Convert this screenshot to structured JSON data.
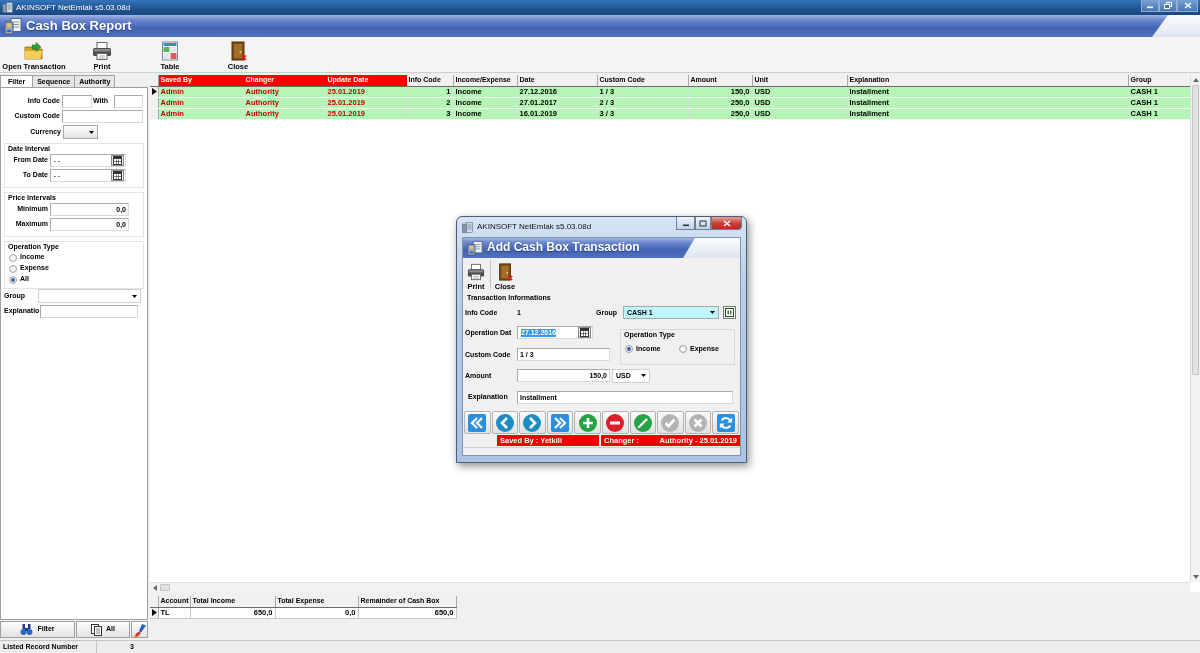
{
  "window": {
    "title": "AKINSOFT NetEmlak s5.03.08d"
  },
  "page_title": "Cash Box Report",
  "toolbar": [
    {
      "kind": "open",
      "label": "Open Transaction"
    },
    {
      "kind": "print",
      "label": "Print"
    },
    {
      "kind": "table",
      "label": "Table"
    },
    {
      "kind": "close",
      "label": "Close"
    }
  ],
  "filter_panel": {
    "tabs": [
      {
        "label": "Filter",
        "selected": true
      },
      {
        "label": "Sequence",
        "selected": false
      },
      {
        "label": "Authority",
        "selected": false
      }
    ],
    "info_code": {
      "label": "Info Code",
      "with_label": "With"
    },
    "custom_code": {
      "label": "Custom Code"
    },
    "currency": {
      "label": "Currency"
    },
    "date_interval": {
      "title": "Date Interval",
      "from_date": {
        "label": "From Date",
        "value": ". ."
      },
      "to_date": {
        "label": "To Date",
        "value": ". ."
      }
    },
    "price_intervals": {
      "title": "Price Intervals",
      "minimum": {
        "label": "Minimum",
        "value": "0,0"
      },
      "maximum": {
        "label": "Maximum",
        "value": "0,0"
      }
    },
    "operation_type": {
      "title": "Operation Type",
      "options": [
        {
          "label": "Income",
          "selected": false
        },
        {
          "label": "Expense",
          "selected": false
        },
        {
          "label": "All",
          "selected": true
        }
      ]
    },
    "group": {
      "label": "Group"
    },
    "explanation": {
      "label": "Explanatio"
    },
    "buttons": [
      {
        "kind": "filter",
        "label": "Filter"
      },
      {
        "kind": "all",
        "label": "All"
      },
      {
        "kind": "clear"
      }
    ]
  },
  "table": {
    "columns": [
      {
        "label": "Saved By",
        "kind": "audit"
      },
      {
        "label": "Changer",
        "kind": "audit"
      },
      {
        "label": "Update Date",
        "kind": "audit"
      },
      {
        "label": "Info Code",
        "kind": "number"
      },
      {
        "label": "Income/Expense",
        "kind": "text"
      },
      {
        "label": "Date",
        "kind": "text"
      },
      {
        "label": "Custom Code",
        "kind": "text"
      },
      {
        "label": "Amount",
        "kind": "number"
      },
      {
        "label": "Unit",
        "kind": "text"
      },
      {
        "label": "Explanation",
        "kind": "text"
      },
      {
        "label": "Group",
        "kind": "text"
      }
    ],
    "rows": [
      {
        "current": true,
        "cells": [
          "Admin",
          "Authority",
          "25.01.2019",
          "1",
          "Income",
          "27.12.2016",
          "1 / 3",
          "150,0",
          "USD",
          "Installment",
          "CASH 1"
        ]
      },
      {
        "current": false,
        "cells": [
          "Admin",
          "Authority",
          "25.01.2019",
          "2",
          "Income",
          "27.01.2017",
          "2 / 3",
          "250,0",
          "USD",
          "Installment",
          "CASH 1"
        ]
      },
      {
        "current": false,
        "cells": [
          "Admin",
          "Authority",
          "25.01.2019",
          "3",
          "Income",
          "16.01.2019",
          "3 / 3",
          "250,0",
          "USD",
          "Installment",
          "CASH 1"
        ]
      }
    ]
  },
  "totals": {
    "columns": [
      {
        "label": "Account",
        "kind": "text"
      },
      {
        "label": "Total Income",
        "kind": "number"
      },
      {
        "label": "Total Expense",
        "kind": "number"
      },
      {
        "label": "Remainder of Cash Box",
        "kind": "number"
      }
    ],
    "rows": [
      {
        "current": true,
        "cells": [
          "TL",
          "650,0",
          "0,0",
          "650,0"
        ]
      }
    ]
  },
  "status_bar": {
    "label": "Listed Record Number",
    "value": "3"
  },
  "dialog": {
    "title": "AKINSOFT NetEmlak s5.03.08d",
    "header": "Add Cash Box Transaction",
    "toolbar": [
      {
        "kind": "print",
        "label": "Print"
      },
      {
        "kind": "close",
        "label": "Close"
      }
    ],
    "section": "Transaction Informations",
    "info_code": {
      "label": "Info Code",
      "value": "1"
    },
    "group": {
      "label": "Group",
      "value": "CASH 1"
    },
    "operation_date": {
      "label": "Operation Dat",
      "value": "27.12.2016",
      "highlighted": true
    },
    "custom_code": {
      "label": "Custom Code",
      "value": "1 / 3"
    },
    "operation_type": {
      "title": "Operation Type",
      "options": [
        {
          "label": "Income",
          "selected": true
        },
        {
          "label": "Expense",
          "selected": false
        }
      ]
    },
    "amount": {
      "label": "Amount",
      "value": "150,0",
      "currency": "USD"
    },
    "explanation": {
      "label": "Explanation",
      "value": "Installment"
    },
    "nav_buttons": [
      {
        "kind": "first",
        "disabled": false
      },
      {
        "kind": "previous",
        "disabled": false
      },
      {
        "kind": "next",
        "disabled": false
      },
      {
        "kind": "last",
        "disabled": false
      },
      {
        "kind": "add",
        "disabled": false
      },
      {
        "kind": "delete",
        "disabled": false
      },
      {
        "kind": "edit",
        "disabled": false
      },
      {
        "kind": "save",
        "disabled": true
      },
      {
        "kind": "cancel",
        "disabled": true
      },
      {
        "kind": "refresh",
        "disabled": false
      }
    ],
    "status": {
      "saved_by": "Saved By : Yetkili",
      "changer_label": "Changer :",
      "changer_value": "Authority - 25.01.2019"
    }
  }
}
